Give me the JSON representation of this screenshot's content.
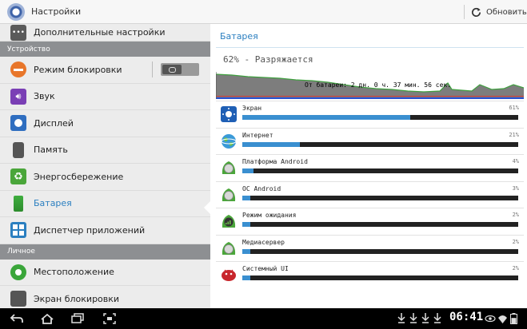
{
  "header": {
    "title": "Настройки",
    "refresh_label": "Обновить"
  },
  "sidebar": {
    "items_top": [
      {
        "label": "Дополнительные настройки",
        "icon": "more-dots-icon",
        "color": "#5a5a5a"
      }
    ],
    "section_device": "Устройство",
    "items_device": [
      {
        "label": "Режим блокировки",
        "icon": "block-mode-icon",
        "color": "#e8762a",
        "toggle": "off"
      },
      {
        "label": "Звук",
        "icon": "speaker-icon",
        "color": "#7a3fb5"
      },
      {
        "label": "Дисплей",
        "icon": "display-icon",
        "color": "#2f6ec0"
      },
      {
        "label": "Память",
        "icon": "sd-card-icon",
        "color": "#555555"
      },
      {
        "label": "Энергосбережение",
        "icon": "recycle-icon",
        "color": "#4aa63a"
      },
      {
        "label": "Батарея",
        "icon": "battery-icon",
        "color": "#3fae3f",
        "selected": true
      },
      {
        "label": "Диспетчер приложений",
        "icon": "apps-grid-icon",
        "color": "#2b7fc0"
      }
    ],
    "section_personal": "Личное",
    "items_personal": [
      {
        "label": "Местоположение",
        "icon": "location-icon",
        "color": "#3aa63a"
      },
      {
        "label": "Экран блокировки",
        "icon": "lock-screen-icon",
        "color": "#555555"
      }
    ]
  },
  "battery": {
    "title": "Батарея",
    "status": "62% - Разряжается",
    "graph_label": "От батареи: 2 дн. 0 ч. 37 мин. 56 сек.",
    "level": 0.62,
    "usage": [
      {
        "name": "Экран",
        "percent": "61%",
        "value": 61,
        "icon": "screen-brightness-icon"
      },
      {
        "name": "Интернет",
        "percent": "21%",
        "value": 21,
        "icon": "globe-icon"
      },
      {
        "name": "Платформа Android",
        "percent": "4%",
        "value": 4,
        "icon": "android-platform-icon"
      },
      {
        "name": "ОС Android",
        "percent": "3%",
        "value": 3,
        "icon": "android-os-icon"
      },
      {
        "name": "Режим ожидания",
        "percent": "2%",
        "value": 2,
        "icon": "standby-signal-icon"
      },
      {
        "name": "Медиасервер",
        "percent": "2%",
        "value": 2,
        "icon": "media-server-icon"
      },
      {
        "name": "Системный UI",
        "percent": "2%",
        "value": 2,
        "icon": "android-robot-icon"
      }
    ]
  },
  "navbar": {
    "time": "06:41"
  },
  "colors": {
    "accent": "#2b7fc0",
    "bar_fill": "#3a8fd0",
    "section_bg": "#8d8f92"
  }
}
